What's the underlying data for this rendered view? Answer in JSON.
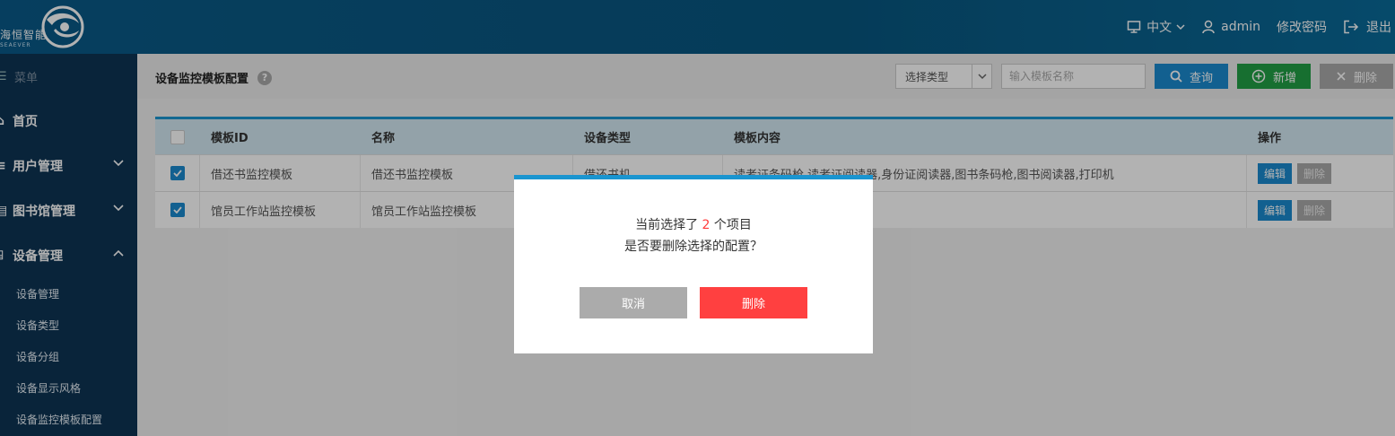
{
  "header": {
    "brand_cn": "海恒智能",
    "brand_en": "SEAEVER",
    "language": "中文",
    "username": "admin",
    "change_password": "修改密码",
    "logout": "退出"
  },
  "sidebar": {
    "menu_label": "菜单",
    "items": [
      {
        "label": "首页"
      },
      {
        "label": "用户管理"
      },
      {
        "label": "图书馆管理"
      },
      {
        "label": "设备管理"
      }
    ],
    "sub_items": [
      {
        "label": "设备管理"
      },
      {
        "label": "设备类型"
      },
      {
        "label": "设备分组"
      },
      {
        "label": "设备显示风格"
      },
      {
        "label": "设备监控模板配置"
      }
    ]
  },
  "page": {
    "title": "设备监控模板配置",
    "help": "?",
    "type_select": "选择类型",
    "search_placeholder": "输入模板名称",
    "query_label": "查询",
    "add_label": "新增",
    "delete_label": "删除"
  },
  "table": {
    "columns": [
      "模板ID",
      "名称",
      "设备类型",
      "模板内容",
      "操作"
    ],
    "rows": [
      {
        "id": "借还书监控模板",
        "name": "借还书监控模板",
        "type": "借还书机",
        "content": "读者证条码枪,读者证阅读器,身份证阅读器,图书条码枪,图书阅读器,打印机",
        "edit": "编辑",
        "delete": "删除",
        "checked": true
      },
      {
        "id": "馆员工作站监控模板",
        "name": "馆员工作站监控模板",
        "type": "",
        "content": "",
        "edit": "编辑",
        "delete": "删除",
        "checked": true
      }
    ]
  },
  "dialog": {
    "line1_prefix": "当前选择了",
    "count": "2",
    "line1_suffix": "个项目",
    "line2": "是否要删除选择的配置？",
    "cancel_label": "取消",
    "confirm_label": "删除"
  },
  "colors": {
    "header_bg": "#0a5a88",
    "sidebar_bg": "#0d3454",
    "accent": "#1a95d0",
    "add_green": "#22a045",
    "danger": "#ff4040"
  }
}
